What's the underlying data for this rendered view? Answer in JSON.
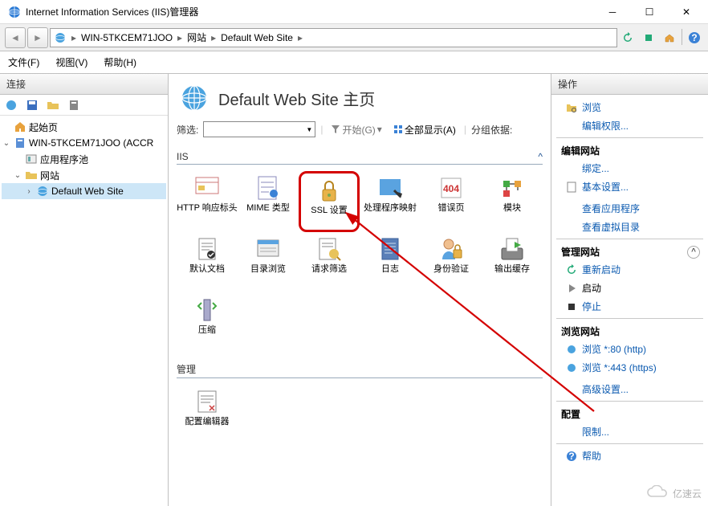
{
  "window": {
    "title": "Internet Information Services (IIS)管理器"
  },
  "breadcrumbs": {
    "server": "WIN-5TKCEM71JOO",
    "sites": "网站",
    "site": "Default Web Site"
  },
  "menu": {
    "file": "文件(F)",
    "view": "视图(V)",
    "help": "帮助(H)"
  },
  "leftPanel": {
    "title": "连接"
  },
  "tree": {
    "start": "起始页",
    "server": "WIN-5TKCEM71JOO (ACCR",
    "apppools": "应用程序池",
    "sites": "网站",
    "default": "Default Web Site"
  },
  "pageTitle": "Default Web Site 主页",
  "filter": {
    "label": "筛选:",
    "go": "开始(G)",
    "showAll": "全部显示(A)",
    "groupBy": "分组依据:"
  },
  "groups": {
    "iis": "IIS",
    "mgmt": "管理",
    "iisItems": [
      {
        "key": "http-headers",
        "label": "HTTP 响应标头"
      },
      {
        "key": "mime-types",
        "label": "MIME 类型"
      },
      {
        "key": "ssl-settings",
        "label": "SSL 设置"
      },
      {
        "key": "handlers",
        "label": "处理程序映射"
      },
      {
        "key": "error-pages",
        "label": "错误页"
      },
      {
        "key": "modules",
        "label": "模块"
      },
      {
        "key": "default-doc",
        "label": "默认文档"
      },
      {
        "key": "dir-browse",
        "label": "目录浏览"
      },
      {
        "key": "request-filter",
        "label": "请求筛选"
      },
      {
        "key": "logging",
        "label": "日志"
      },
      {
        "key": "auth",
        "label": "身份验证"
      },
      {
        "key": "output-cache",
        "label": "输出缓存"
      },
      {
        "key": "compression",
        "label": "压缩"
      }
    ],
    "mgmtItems": [
      {
        "key": "config-editor",
        "label": "配置编辑器"
      }
    ]
  },
  "rightPanel": {
    "title": "操作",
    "explore": "浏览",
    "editPerm": "编辑权限...",
    "editSite": "编辑网站",
    "bindings": "绑定...",
    "basicSettings": "基本设置...",
    "viewApps": "查看应用程序",
    "viewVDirs": "查看虚拟目录",
    "manageSite": "管理网站",
    "restart": "重新启动",
    "start": "启动",
    "stop": "停止",
    "browseSite": "浏览网站",
    "browse80": "浏览 *:80 (http)",
    "browse443": "浏览 *:443 (https)",
    "advanced": "高级设置...",
    "configure": "配置",
    "limits": "限制...",
    "help": "帮助"
  },
  "watermark": "亿速云"
}
